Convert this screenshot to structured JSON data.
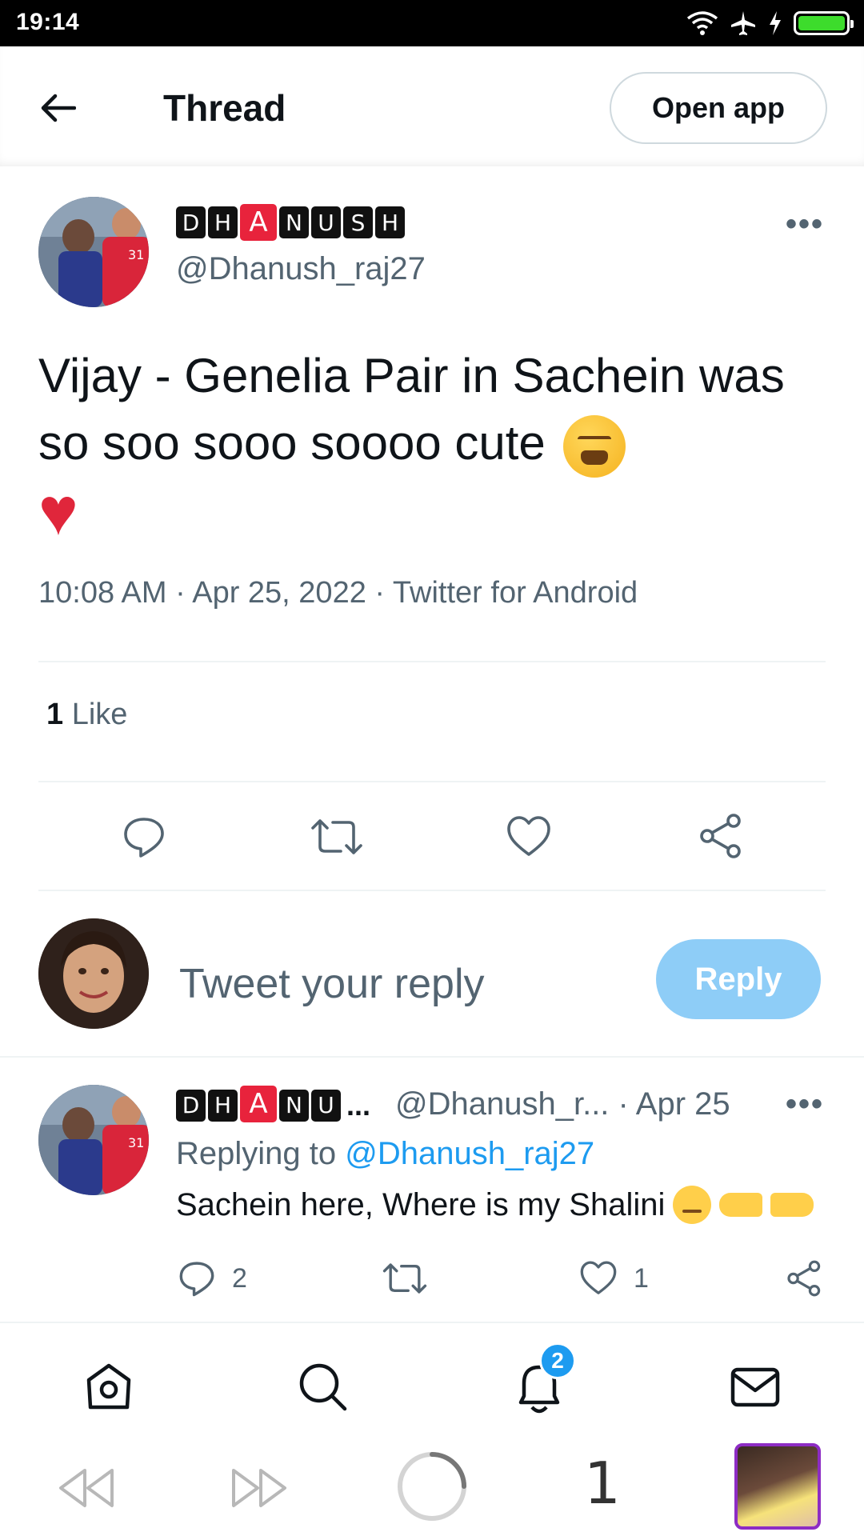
{
  "status_bar": {
    "time": "19:14",
    "battery_level": 1.0
  },
  "header": {
    "title": "Thread",
    "open_app_label": "Open app"
  },
  "main_tweet": {
    "display_name_tiles": [
      "D",
      "H",
      "A",
      "N",
      "U",
      "S",
      "H"
    ],
    "handle": "@Dhanush_raj27",
    "text": "Vijay - Genelia Pair in Sachein was so soo sooo soooo cute",
    "timestamp": "10:08 AM · Apr 25, 2022 · Twitter for Android",
    "likes_count": "1",
    "likes_label": "Like"
  },
  "reply_box": {
    "placeholder": "Tweet your reply",
    "button_label": "Reply"
  },
  "comment": {
    "display_name_tiles": [
      "D",
      "H",
      "A",
      "N",
      "U"
    ],
    "ellipsis": "...",
    "handle_date": "@Dhanush_r... · Apr 25",
    "replying_prefix": "Replying to ",
    "replying_mention": "@Dhanush_raj27",
    "text": "Sachein here, Where is my Shalini",
    "reply_count": "2",
    "like_count": "1"
  },
  "bottom_nav": {
    "notifications_badge": "2"
  },
  "browser": {
    "tab_count": "1"
  },
  "colors": {
    "accent": "#1d9bf0",
    "reply_button": "#8ecdf7",
    "muted_text": "#536471",
    "heart": "#e0263b"
  }
}
